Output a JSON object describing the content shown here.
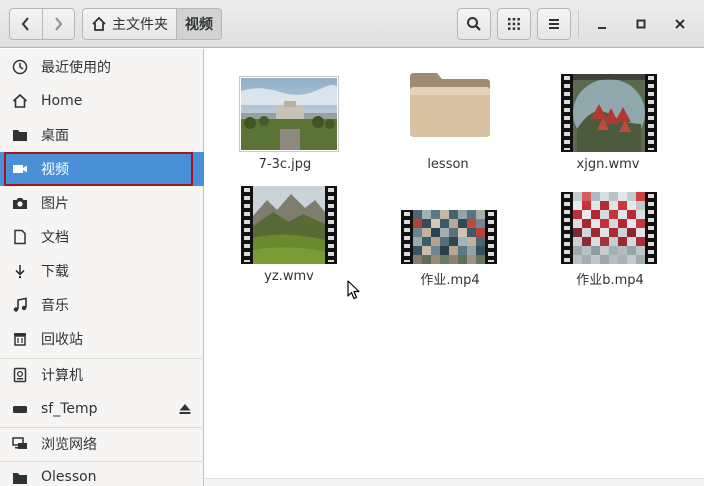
{
  "header": {
    "crumbs": [
      {
        "label": "主文件夹"
      },
      {
        "label": "视频"
      }
    ]
  },
  "sidebar": {
    "items": [
      {
        "label": "最近使用的"
      },
      {
        "label": "Home"
      },
      {
        "label": "桌面"
      },
      {
        "label": "视频"
      },
      {
        "label": "图片"
      },
      {
        "label": "文档"
      },
      {
        "label": "下载"
      },
      {
        "label": "音乐"
      },
      {
        "label": "回收站"
      },
      {
        "label": "计算机"
      },
      {
        "label": "sf_Temp"
      },
      {
        "label": "浏览网络"
      },
      {
        "label": "Olesson"
      }
    ]
  },
  "files": [
    {
      "name": "7-3c.jpg",
      "kind": "image"
    },
    {
      "name": "lesson",
      "kind": "folder"
    },
    {
      "name": "xjgn.wmv",
      "kind": "video"
    },
    {
      "name": "yz.wmv",
      "kind": "video"
    },
    {
      "name": "作业.mp4",
      "kind": "video"
    },
    {
      "name": "作业b.mp4",
      "kind": "video"
    }
  ],
  "colors": {
    "selection": "#4a90d9",
    "highlight_outline": "#a4161a"
  }
}
